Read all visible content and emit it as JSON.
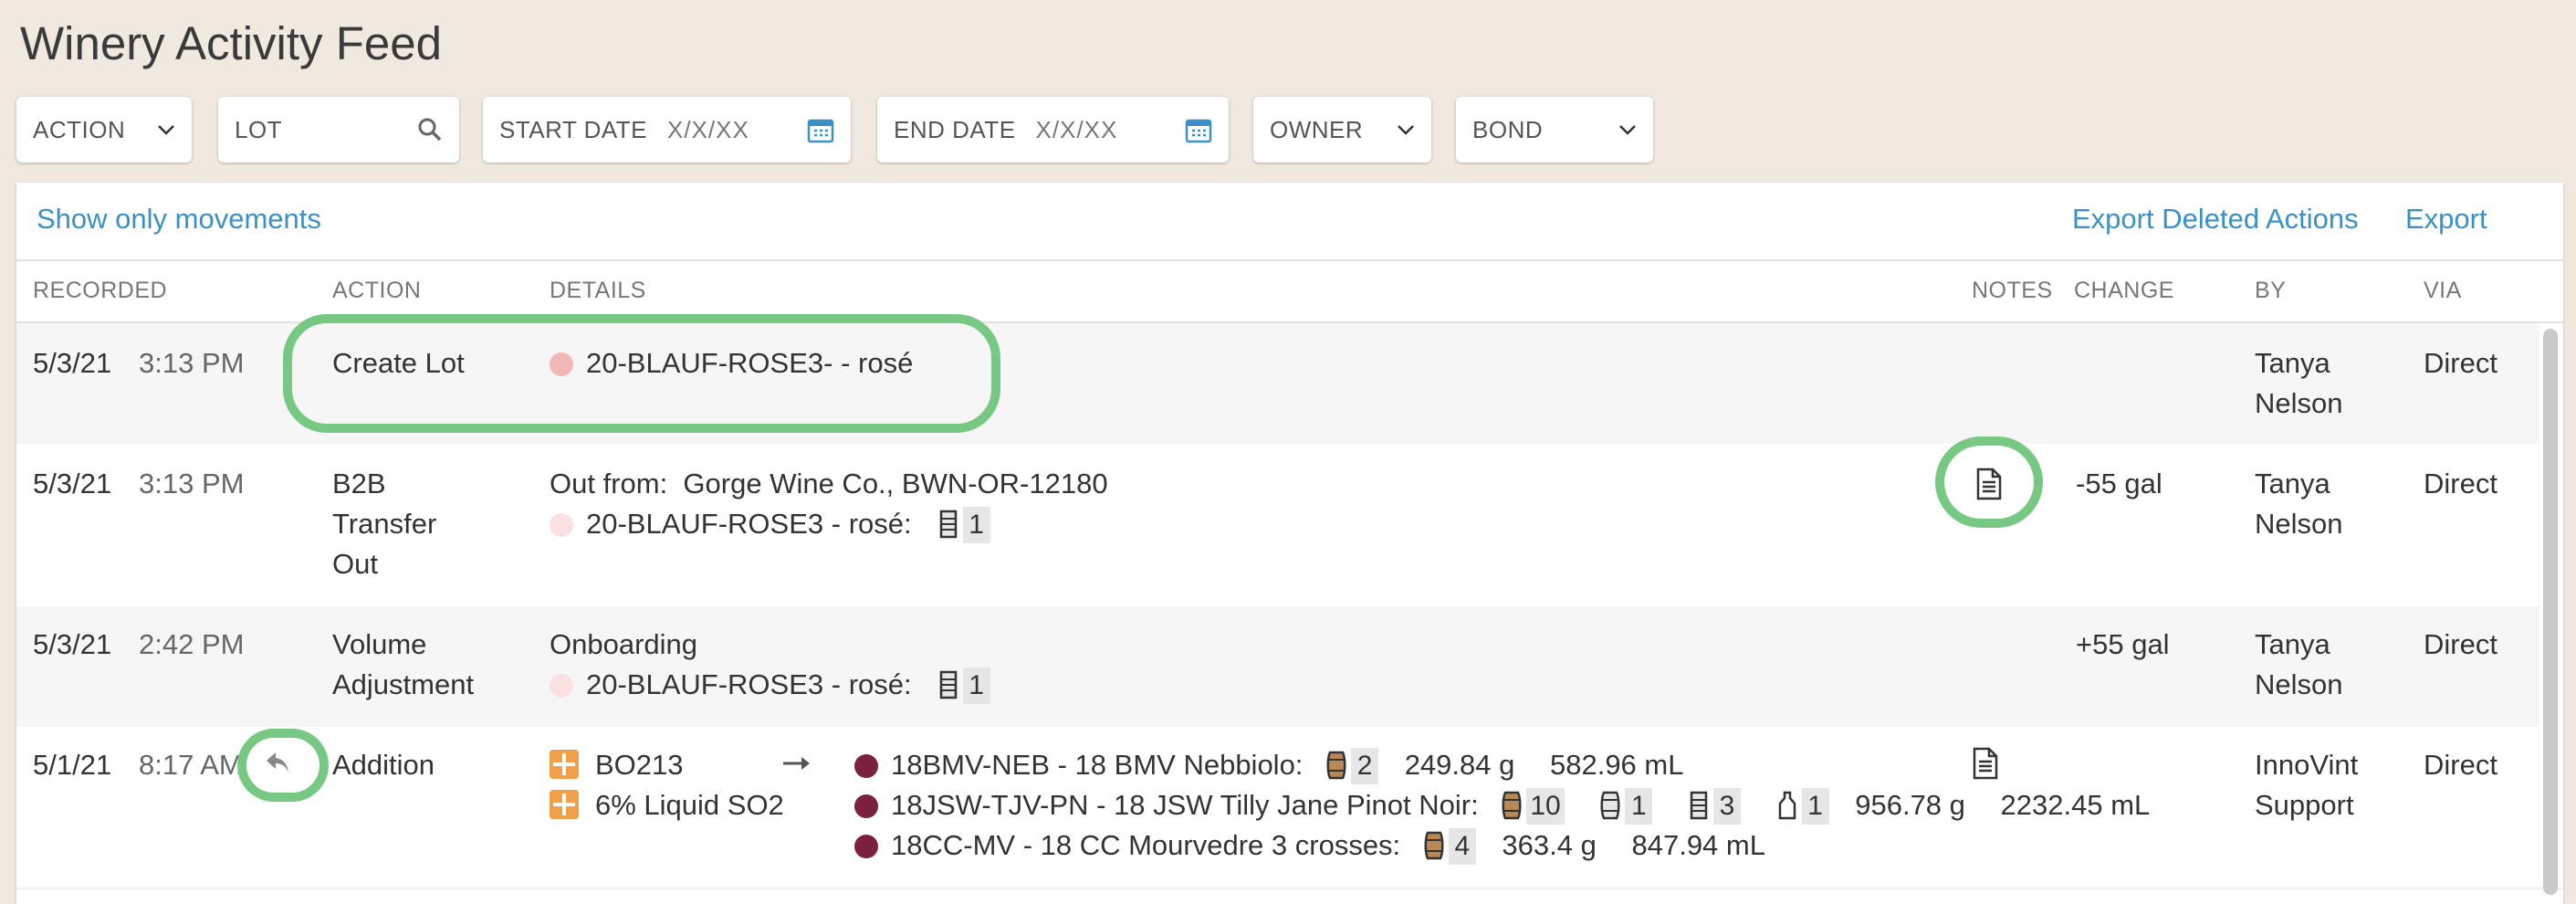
{
  "page_title": "Winery Activity Feed",
  "filters": {
    "action": "ACTION",
    "lot": "LOT",
    "start_date": "START DATE",
    "start_placeholder": "X/X/XX",
    "end_date": "END DATE",
    "end_placeholder": "X/X/XX",
    "owner": "OWNER",
    "bond": "BOND"
  },
  "toolbar": {
    "show_movements": "Show only movements",
    "export_deleted": "Export Deleted Actions",
    "export": "Export"
  },
  "columns": {
    "recorded": "RECORDED",
    "action": "ACTION",
    "details": "DETAILS",
    "notes": "NOTES",
    "change": "CHANGE",
    "by": "BY",
    "via": "VIA"
  },
  "rows": [
    {
      "date": "5/3/21",
      "time": "3:13 PM",
      "action": "Create Lot",
      "lot": "20-BLAUF-ROSE3- - rosé",
      "lot_color": "#f2b8b8",
      "by_first": "Tanya",
      "by_last": "Nelson",
      "via": "Direct"
    },
    {
      "date": "5/3/21",
      "time": "3:13 PM",
      "action_1": "B2B",
      "action_2": "Transfer",
      "action_3": "Out",
      "detail_line": "Out from:  Gorge Wine Co., BWN-OR-12180",
      "lot": "20-BLAUF-ROSE3 - rosé:",
      "lot_color": "#fbe1e1",
      "vessel_count": "1",
      "change": "-55 gal",
      "by_first": "Tanya",
      "by_last": "Nelson",
      "via": "Direct"
    },
    {
      "date": "5/3/21",
      "time": "2:42 PM",
      "action_1": "Volume",
      "action_2": "Adjustment",
      "detail_line": "Onboarding",
      "lot": "20-BLAUF-ROSE3 - rosé:",
      "lot_color": "#fbe1e1",
      "vessel_count": "1",
      "change": "+55 gal",
      "by_first": "Tanya",
      "by_last": "Nelson",
      "via": "Direct"
    },
    {
      "date": "5/1/21",
      "time": "8:17 AM",
      "action": "Addition",
      "additive_1": "BO213",
      "additive_2": "6% Liquid SO2",
      "lots": [
        {
          "name": "18BMV-NEB - 18 BMV Nebbiolo:",
          "barrels": "2",
          "grams": "249.84 g",
          "ml": "582.96 mL"
        },
        {
          "name": "18JSW-TJV-PN - 18 JSW Tilly Jane Pinot Noir:",
          "barrels": "10",
          "steel": "1",
          "tanks": "3",
          "bottles": "1",
          "grams": "956.78 g",
          "ml": "2232.45 mL"
        },
        {
          "name": "18CC-MV - 18 CC Mourvedre 3 crosses:",
          "barrels": "4",
          "grams": "363.4 g",
          "ml": "847.94 mL"
        }
      ],
      "lot_color": "#7a2140",
      "by_first": "InnoVint",
      "by_last": "Support",
      "via": "Direct"
    }
  ],
  "colors": {
    "accent": "#3a91c8",
    "highlight": "#77c883",
    "additive": "#f0a048"
  }
}
